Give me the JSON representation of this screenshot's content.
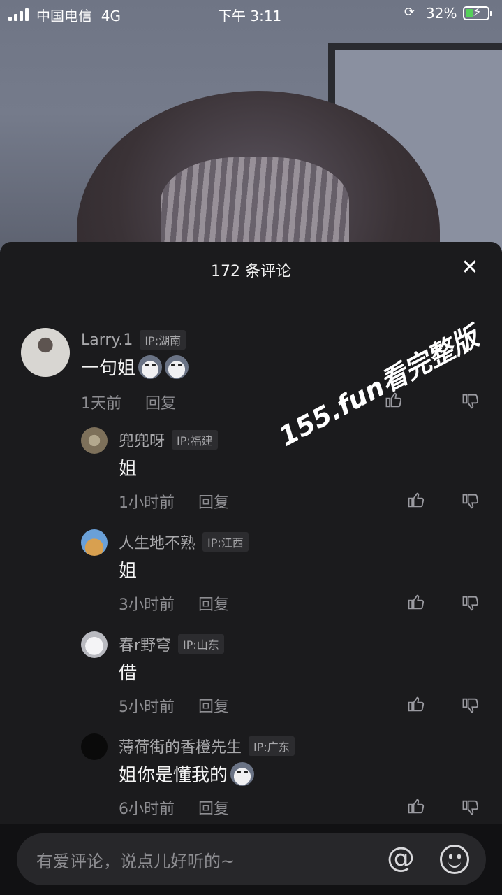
{
  "status_bar": {
    "carrier": "中国电信",
    "network": "4G",
    "time": "下午 3:11",
    "battery_percent": "32%",
    "battery_level": 0.32,
    "charging": true
  },
  "sheet": {
    "title": "172 条评论",
    "close_icon": "close-icon"
  },
  "comments": [
    {
      "name": "Larry.1",
      "ip": "IP:湖南",
      "text": "一句姐",
      "emojis": 2,
      "time": "1天前",
      "reply": "回复",
      "avatar_color": "#c9c6c0"
    },
    {
      "name": "兜兜呀",
      "ip": "IP:福建",
      "text": "姐",
      "emojis": 0,
      "time": "1小时前",
      "reply": "回复",
      "avatar_color": "#8a7d66"
    },
    {
      "name": "人生地不熟",
      "ip": "IP:江西",
      "text": "姐",
      "emojis": 0,
      "time": "3小时前",
      "reply": "回复",
      "avatar_color": "#d3a45a"
    },
    {
      "name": "春r野穹",
      "ip": "IP:山东",
      "text": "借",
      "emojis": 0,
      "time": "5小时前",
      "reply": "回复",
      "avatar_color": "#e2e2e6"
    },
    {
      "name": "薄荷街的香橙先生",
      "ip": "IP:广东",
      "text": "姐你是懂我的",
      "emojis": 1,
      "time": "6小时前",
      "reply": "回复",
      "avatar_color": "#0a0a0a"
    }
  ],
  "watermark": "155.fun看完整版",
  "input": {
    "placeholder": "有爱评论，说点儿好听的~",
    "at_symbol": "@"
  }
}
